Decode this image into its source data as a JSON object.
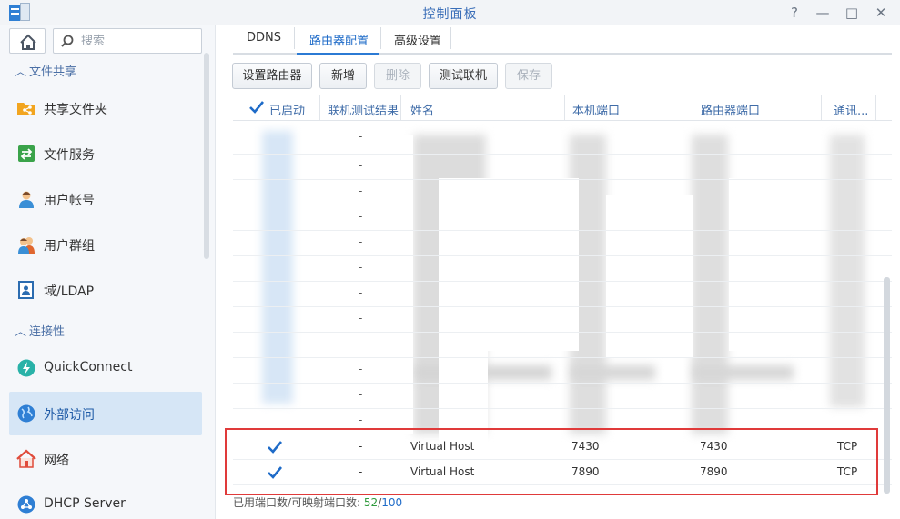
{
  "window": {
    "title": "控制面板",
    "controls": [
      "?",
      "—",
      "□",
      "✕"
    ]
  },
  "sidebar": {
    "search_placeholder": "搜索",
    "sections": [
      {
        "label": "文件共享",
        "items": [
          {
            "label": "共享文件夹",
            "icon": "shared-folder-icon"
          },
          {
            "label": "文件服务",
            "icon": "file-services-icon"
          },
          {
            "label": "用户帐号",
            "icon": "user-icon"
          },
          {
            "label": "用户群组",
            "icon": "group-icon"
          },
          {
            "label": "域/LDAP",
            "icon": "domain-ldap-icon"
          }
        ]
      },
      {
        "label": "连接性",
        "items": [
          {
            "label": "QuickConnect",
            "icon": "quickconnect-icon"
          },
          {
            "label": "外部访问",
            "icon": "globe-icon",
            "active": true
          },
          {
            "label": "网络",
            "icon": "network-house-icon"
          },
          {
            "label": "DHCP Server",
            "icon": "dhcp-icon"
          }
        ]
      }
    ]
  },
  "tabs": [
    {
      "label": "DDNS"
    },
    {
      "label": "路由器配置",
      "active": true
    },
    {
      "label": "高级设置"
    }
  ],
  "toolbar": {
    "setup_router": "设置路由器",
    "add": "新增",
    "delete": "删除",
    "test_connection": "测试联机",
    "save": "保存"
  },
  "table": {
    "headers": {
      "enabled": "已启动",
      "test_result": "联机测试结果",
      "name": "姓名",
      "local_port": "本机端口",
      "router_port": "路由器端口",
      "protocol": "通讯..."
    },
    "blurred_row_test_result": "-",
    "blurred_row_count": 12,
    "rows": [
      {
        "enabled": true,
        "test_result": "-",
        "name": "Virtual Host",
        "local_port": "7430",
        "router_port": "7430",
        "protocol": "TCP"
      },
      {
        "enabled": true,
        "test_result": "-",
        "name": "Virtual Host",
        "local_port": "7890",
        "router_port": "7890",
        "protocol": "TCP"
      }
    ]
  },
  "footer": {
    "label": "已用端口数/可映射端口数: ",
    "used": "52",
    "separator": "/",
    "total": "100"
  },
  "colors": {
    "accent": "#1e6bc8",
    "active_item_bg": "#d6e6f6",
    "highlight_border": "#e03a3a",
    "used_count": "#2f9a3d"
  }
}
